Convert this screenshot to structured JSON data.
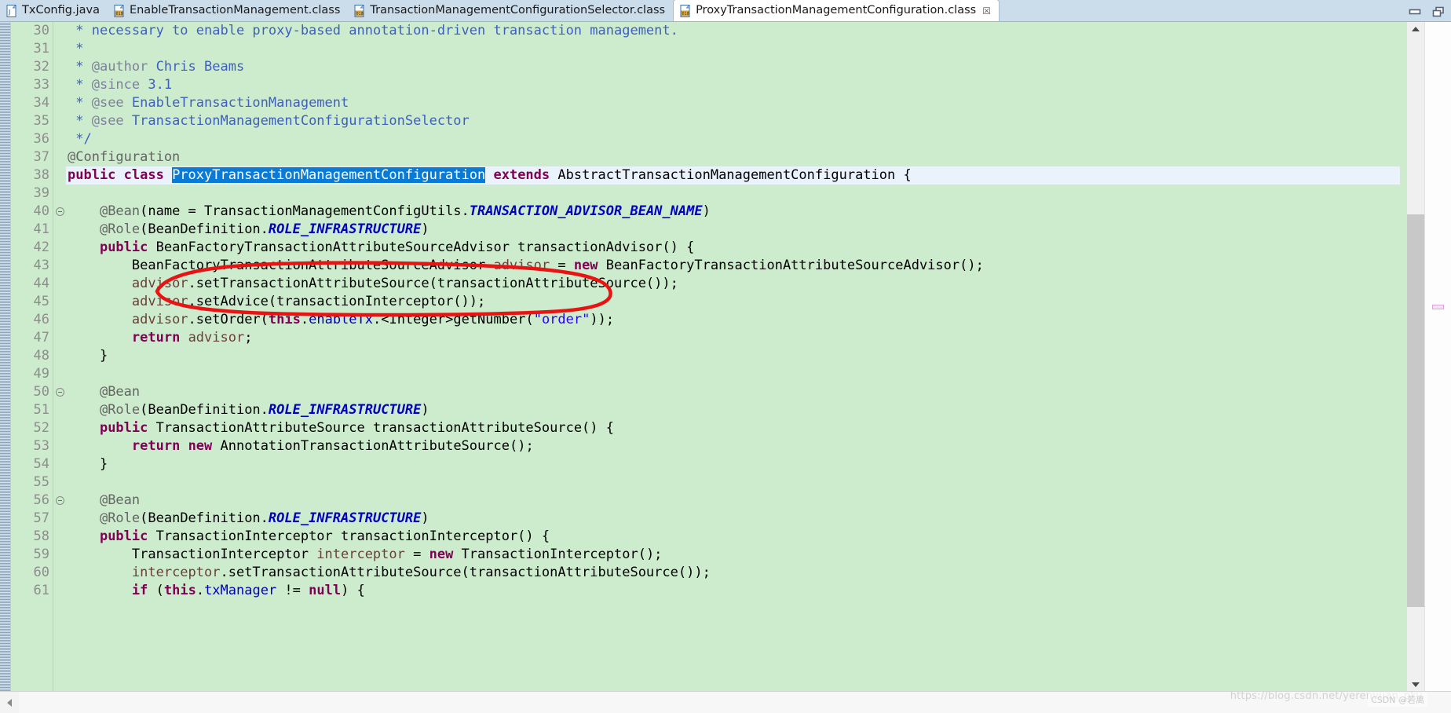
{
  "window": {
    "minimize_label": "Minimize",
    "maximize_label": "Maximize",
    "minimize_icon": "minimize-icon",
    "maximize_icon": "restore-icon"
  },
  "tabs": [
    {
      "label": "TxConfig.java",
      "icon": "java-file-icon",
      "active": false,
      "closable": false
    },
    {
      "label": "EnableTransactionManagement.class",
      "icon": "class-file-icon",
      "active": false,
      "closable": false
    },
    {
      "label": "TransactionManagementConfigurationSelector.class",
      "icon": "class-file-icon",
      "active": false,
      "closable": false
    },
    {
      "label": "ProxyTransactionManagementConfiguration.class",
      "icon": "class-file-icon",
      "active": true,
      "closable": true,
      "close_glyph": "☒"
    }
  ],
  "editor": {
    "background_color": "#cdeccd",
    "current_line_color": "#eaf2fb",
    "selection_color": "#0a7bd5",
    "first_line": 30,
    "lines": [
      {
        "number": 30,
        "fold": false,
        "current": false,
        "tokens": [
          {
            "text": " * ",
            "style": "t-cmt"
          },
          {
            "text": "necessary to enable proxy-based annotation-driven transaction management.",
            "style": "t-cmt"
          }
        ]
      },
      {
        "number": 31,
        "fold": false,
        "current": false,
        "tokens": [
          {
            "text": " *",
            "style": "t-cmt"
          }
        ]
      },
      {
        "number": 32,
        "fold": false,
        "current": false,
        "tokens": [
          {
            "text": " * ",
            "style": "t-cmt"
          },
          {
            "text": "@author",
            "style": "t-tag"
          },
          {
            "text": " Chris Beams",
            "style": "t-cmt"
          }
        ]
      },
      {
        "number": 33,
        "fold": false,
        "current": false,
        "tokens": [
          {
            "text": " * ",
            "style": "t-cmt"
          },
          {
            "text": "@since",
            "style": "t-tag"
          },
          {
            "text": " 3.1",
            "style": "t-cmt"
          }
        ]
      },
      {
        "number": 34,
        "fold": false,
        "current": false,
        "tokens": [
          {
            "text": " * ",
            "style": "t-cmt"
          },
          {
            "text": "@see",
            "style": "t-tag"
          },
          {
            "text": " EnableTransactionManagement",
            "style": "t-cmt"
          }
        ]
      },
      {
        "number": 35,
        "fold": false,
        "current": false,
        "tokens": [
          {
            "text": " * ",
            "style": "t-cmt"
          },
          {
            "text": "@see",
            "style": "t-tag"
          },
          {
            "text": " TransactionManagementConfigurationSelector",
            "style": "t-cmt"
          }
        ]
      },
      {
        "number": 36,
        "fold": false,
        "current": false,
        "tokens": [
          {
            "text": " */",
            "style": "t-cmt"
          }
        ]
      },
      {
        "number": 37,
        "fold": false,
        "current": false,
        "tokens": [
          {
            "text": "@Configuration",
            "style": "t-ann"
          }
        ]
      },
      {
        "number": 38,
        "fold": false,
        "current": true,
        "tokens": [
          {
            "text": "public class ",
            "style": "t-kw"
          },
          {
            "text": "ProxyTransactionManagementConfiguration",
            "style": "t-sel"
          },
          {
            "text": " ",
            "style": "t-plain"
          },
          {
            "text": "extends",
            "style": "t-kw"
          },
          {
            "text": " AbstractTransactionManagementConfiguration {",
            "style": "t-plain"
          }
        ]
      },
      {
        "number": 39,
        "fold": false,
        "current": false,
        "tokens": [
          {
            "text": "",
            "style": "t-plain"
          }
        ]
      },
      {
        "number": 40,
        "fold": true,
        "current": false,
        "tokens": [
          {
            "text": "    ",
            "style": "t-plain"
          },
          {
            "text": "@Bean",
            "style": "t-ann"
          },
          {
            "text": "(name = TransactionManagementConfigUtils.",
            "style": "t-plain"
          },
          {
            "text": "TRANSACTION_ADVISOR_BEAN_NAME",
            "style": "t-sf"
          },
          {
            "text": ")",
            "style": "t-plain"
          }
        ]
      },
      {
        "number": 41,
        "fold": false,
        "current": false,
        "tokens": [
          {
            "text": "    ",
            "style": "t-plain"
          },
          {
            "text": "@Role",
            "style": "t-ann"
          },
          {
            "text": "(BeanDefinition.",
            "style": "t-plain"
          },
          {
            "text": "ROLE_INFRASTRUCTURE",
            "style": "t-sf"
          },
          {
            "text": ")",
            "style": "t-plain"
          }
        ]
      },
      {
        "number": 42,
        "fold": false,
        "current": false,
        "tokens": [
          {
            "text": "    ",
            "style": "t-plain"
          },
          {
            "text": "public",
            "style": "t-kw"
          },
          {
            "text": " BeanFactoryTransactionAttributeSourceAdvisor transactionAdvisor() {",
            "style": "t-plain"
          }
        ]
      },
      {
        "number": 43,
        "fold": false,
        "current": false,
        "tokens": [
          {
            "text": "        BeanFactoryTransactionAttributeSourceAdvisor ",
            "style": "t-plain"
          },
          {
            "text": "advisor",
            "style": "t-loc"
          },
          {
            "text": " = ",
            "style": "t-plain"
          },
          {
            "text": "new",
            "style": "t-kw"
          },
          {
            "text": " BeanFactoryTransactionAttributeSourceAdvisor();",
            "style": "t-plain"
          }
        ]
      },
      {
        "number": 44,
        "fold": false,
        "current": false,
        "tokens": [
          {
            "text": "        ",
            "style": "t-plain"
          },
          {
            "text": "advisor",
            "style": "t-loc"
          },
          {
            "text": ".setTransactionAttributeSource(transactionAttributeSource());",
            "style": "t-plain"
          }
        ]
      },
      {
        "number": 45,
        "fold": false,
        "current": false,
        "tokens": [
          {
            "text": "        ",
            "style": "t-plain"
          },
          {
            "text": "advisor",
            "style": "t-loc"
          },
          {
            "text": ".setAdvice(transactionInterceptor());",
            "style": "t-plain"
          }
        ]
      },
      {
        "number": 46,
        "fold": false,
        "current": false,
        "tokens": [
          {
            "text": "        ",
            "style": "t-plain"
          },
          {
            "text": "advisor",
            "style": "t-loc"
          },
          {
            "text": ".setOrder(",
            "style": "t-plain"
          },
          {
            "text": "this",
            "style": "t-kw"
          },
          {
            "text": ".",
            "style": "t-plain"
          },
          {
            "text": "enableTx",
            "style": "t-fld"
          },
          {
            "text": ".<Integer>getNumber(",
            "style": "t-plain"
          },
          {
            "text": "\"order\"",
            "style": "t-str"
          },
          {
            "text": "));",
            "style": "t-plain"
          }
        ]
      },
      {
        "number": 47,
        "fold": false,
        "current": false,
        "tokens": [
          {
            "text": "        ",
            "style": "t-plain"
          },
          {
            "text": "return",
            "style": "t-kw"
          },
          {
            "text": " ",
            "style": "t-plain"
          },
          {
            "text": "advisor",
            "style": "t-loc"
          },
          {
            "text": ";",
            "style": "t-plain"
          }
        ]
      },
      {
        "number": 48,
        "fold": false,
        "current": false,
        "tokens": [
          {
            "text": "    }",
            "style": "t-plain"
          }
        ]
      },
      {
        "number": 49,
        "fold": false,
        "current": false,
        "tokens": [
          {
            "text": "",
            "style": "t-plain"
          }
        ]
      },
      {
        "number": 50,
        "fold": true,
        "current": false,
        "tokens": [
          {
            "text": "    ",
            "style": "t-plain"
          },
          {
            "text": "@Bean",
            "style": "t-ann"
          }
        ]
      },
      {
        "number": 51,
        "fold": false,
        "current": false,
        "tokens": [
          {
            "text": "    ",
            "style": "t-plain"
          },
          {
            "text": "@Role",
            "style": "t-ann"
          },
          {
            "text": "(BeanDefinition.",
            "style": "t-plain"
          },
          {
            "text": "ROLE_INFRASTRUCTURE",
            "style": "t-sf"
          },
          {
            "text": ")",
            "style": "t-plain"
          }
        ]
      },
      {
        "number": 52,
        "fold": false,
        "current": false,
        "tokens": [
          {
            "text": "    ",
            "style": "t-plain"
          },
          {
            "text": "public",
            "style": "t-kw"
          },
          {
            "text": " TransactionAttributeSource transactionAttributeSource() {",
            "style": "t-plain"
          }
        ]
      },
      {
        "number": 53,
        "fold": false,
        "current": false,
        "tokens": [
          {
            "text": "        ",
            "style": "t-plain"
          },
          {
            "text": "return",
            "style": "t-kw"
          },
          {
            "text": " ",
            "style": "t-plain"
          },
          {
            "text": "new",
            "style": "t-kw"
          },
          {
            "text": " AnnotationTransactionAttributeSource();",
            "style": "t-plain"
          }
        ]
      },
      {
        "number": 54,
        "fold": false,
        "current": false,
        "tokens": [
          {
            "text": "    }",
            "style": "t-plain"
          }
        ]
      },
      {
        "number": 55,
        "fold": false,
        "current": false,
        "tokens": [
          {
            "text": "",
            "style": "t-plain"
          }
        ]
      },
      {
        "number": 56,
        "fold": true,
        "current": false,
        "tokens": [
          {
            "text": "    ",
            "style": "t-plain"
          },
          {
            "text": "@Bean",
            "style": "t-ann"
          }
        ]
      },
      {
        "number": 57,
        "fold": false,
        "current": false,
        "tokens": [
          {
            "text": "    ",
            "style": "t-plain"
          },
          {
            "text": "@Role",
            "style": "t-ann"
          },
          {
            "text": "(BeanDefinition.",
            "style": "t-plain"
          },
          {
            "text": "ROLE_INFRASTRUCTURE",
            "style": "t-sf"
          },
          {
            "text": ")",
            "style": "t-plain"
          }
        ]
      },
      {
        "number": 58,
        "fold": false,
        "current": false,
        "tokens": [
          {
            "text": "    ",
            "style": "t-plain"
          },
          {
            "text": "public",
            "style": "t-kw"
          },
          {
            "text": " TransactionInterceptor transactionInterceptor() {",
            "style": "t-plain"
          }
        ]
      },
      {
        "number": 59,
        "fold": false,
        "current": false,
        "tokens": [
          {
            "text": "        TransactionInterceptor ",
            "style": "t-plain"
          },
          {
            "text": "interceptor",
            "style": "t-loc"
          },
          {
            "text": " = ",
            "style": "t-plain"
          },
          {
            "text": "new",
            "style": "t-kw"
          },
          {
            "text": " TransactionInterceptor();",
            "style": "t-plain"
          }
        ]
      },
      {
        "number": 60,
        "fold": false,
        "current": false,
        "tokens": [
          {
            "text": "        ",
            "style": "t-plain"
          },
          {
            "text": "interceptor",
            "style": "t-loc"
          },
          {
            "text": ".setTransactionAttributeSource(transactionAttributeSource());",
            "style": "t-plain"
          }
        ]
      },
      {
        "number": 61,
        "fold": false,
        "current": false,
        "tokens": [
          {
            "text": "        ",
            "style": "t-plain"
          },
          {
            "text": "if",
            "style": "t-kw"
          },
          {
            "text": " (",
            "style": "t-plain"
          },
          {
            "text": "this",
            "style": "t-kw"
          },
          {
            "text": ".",
            "style": "t-plain"
          },
          {
            "text": "txManager",
            "style": "t-fld"
          },
          {
            "text": " != ",
            "style": "t-plain"
          },
          {
            "text": "null",
            "style": "t-kw"
          },
          {
            "text": ") {",
            "style": "t-plain"
          }
        ]
      }
    ]
  },
  "annotation": {
    "shape": "hand-drawn-ellipse",
    "color": "#e81414",
    "target_text": "BeanFactoryTransactionAttributeSourceAdvisor",
    "target_line": 42
  },
  "scrollbars": {
    "vertical": {
      "up_arrow": "chevron-up-icon",
      "down_arrow": "chevron-down-icon",
      "thumb": "scroll-thumb"
    },
    "horizontal": {
      "left_arrow": "chevron-left-icon"
    }
  },
  "watermark": {
    "url": "https://blog.csdn.net/yerenyuan_pku",
    "badge": "CSDN @若离"
  }
}
